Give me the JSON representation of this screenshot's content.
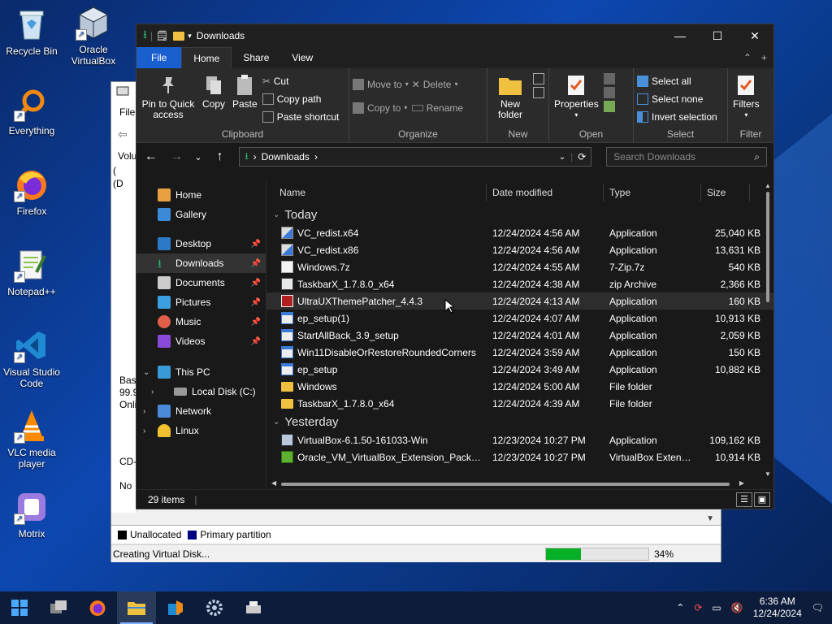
{
  "desktop": {
    "icons": [
      {
        "label": "Recycle Bin"
      },
      {
        "label": "Oracle VirtualBox"
      },
      {
        "label": "Everything"
      },
      {
        "label": "Firefox"
      },
      {
        "label": "Notepad++"
      },
      {
        "label": "Visual Studio Code"
      },
      {
        "label": "VLC media player"
      },
      {
        "label": "Motrix"
      }
    ]
  },
  "background_window": {
    "menu_file": "File",
    "col_volume": "Volu",
    "rows": [
      "(",
      "(D"
    ],
    "disk_info": [
      "Basi",
      "99.9",
      "Onli"
    ],
    "cd": "CD-",
    "cd_status": "No",
    "legend": [
      {
        "label": "Unallocated",
        "color": "#000000"
      },
      {
        "label": "Primary partition",
        "color": "#000080"
      }
    ],
    "status_text": "Creating Virtual Disk...",
    "progress_percent": 34,
    "progress_label": "34%"
  },
  "explorer": {
    "title": "Downloads",
    "tabs": {
      "file": "File",
      "home": "Home",
      "share": "Share",
      "view": "View"
    },
    "ribbon": {
      "clipboard": {
        "pin": "Pin to Quick access",
        "copy": "Copy",
        "paste": "Paste",
        "cut": "Cut",
        "copy_path": "Copy path",
        "paste_shortcut": "Paste shortcut",
        "label": "Clipboard"
      },
      "organize": {
        "move_to": "Move to",
        "copy_to": "Copy to",
        "delete": "Delete",
        "rename": "Rename",
        "label": "Organize"
      },
      "new": {
        "new_folder": "New folder",
        "label": "New"
      },
      "open": {
        "properties": "Properties",
        "label": "Open"
      },
      "select": {
        "select_all": "Select all",
        "select_none": "Select none",
        "invert": "Invert selection",
        "label": "Select"
      },
      "filter": {
        "filters": "Filters",
        "label": "Filter"
      }
    },
    "address": {
      "path": "Downloads"
    },
    "search": {
      "placeholder": "Search Downloads"
    },
    "nav": {
      "home": "Home",
      "gallery": "Gallery",
      "desktop": "Desktop",
      "downloads": "Downloads",
      "documents": "Documents",
      "pictures": "Pictures",
      "music": "Music",
      "videos": "Videos",
      "this_pc": "This PC",
      "local_disk": "Local Disk (C:)",
      "network": "Network",
      "linux": "Linux"
    },
    "columns": {
      "name": "Name",
      "date": "Date modified",
      "type": "Type",
      "size": "Size"
    },
    "groups": {
      "today": "Today",
      "yesterday": "Yesterday"
    },
    "files_today": [
      {
        "name": "VC_redist.x64",
        "date": "12/24/2024 4:56 AM",
        "type": "Application",
        "size": "25,040 KB",
        "icon": "installer"
      },
      {
        "name": "VC_redist.x86",
        "date": "12/24/2024 4:56 AM",
        "type": "Application",
        "size": "13,631 KB",
        "icon": "installer"
      },
      {
        "name": "Windows.7z",
        "date": "12/24/2024 4:55 AM",
        "type": "7-Zip.7z",
        "size": "540 KB",
        "icon": "file"
      },
      {
        "name": "TaskbarX_1.7.8.0_x64",
        "date": "12/24/2024 4:38 AM",
        "type": "zip Archive",
        "size": "2,366 KB",
        "icon": "zip"
      },
      {
        "name": "UltraUXThemePatcher_4.4.3",
        "date": "12/24/2024 4:13 AM",
        "type": "Application",
        "size": "160 KB",
        "icon": "patcher"
      },
      {
        "name": "ep_setup(1)",
        "date": "12/24/2024 4:07 AM",
        "type": "Application",
        "size": "10,913 KB",
        "icon": "app"
      },
      {
        "name": "StartAllBack_3.9_setup",
        "date": "12/24/2024 4:01 AM",
        "type": "Application",
        "size": "2,059 KB",
        "icon": "app"
      },
      {
        "name": "Win11DisableOrRestoreRoundedCorners",
        "date": "12/24/2024 3:59 AM",
        "type": "Application",
        "size": "150 KB",
        "icon": "app"
      },
      {
        "name": "ep_setup",
        "date": "12/24/2024 3:49 AM",
        "type": "Application",
        "size": "10,882 KB",
        "icon": "app"
      },
      {
        "name": "Windows",
        "date": "12/24/2024 5:00 AM",
        "type": "File folder",
        "size": "",
        "icon": "folder"
      },
      {
        "name": "TaskbarX_1.7.8.0_x64",
        "date": "12/24/2024 4:39 AM",
        "type": "File folder",
        "size": "",
        "icon": "folder"
      }
    ],
    "files_yesterday": [
      {
        "name": "VirtualBox-6.1.50-161033-Win",
        "date": "12/23/2024 10:27 PM",
        "type": "Application",
        "size": "109,162 KB",
        "icon": "vbox"
      },
      {
        "name": "Oracle_VM_VirtualBox_Extension_Pack-6....",
        "date": "12/23/2024 10:27 PM",
        "type": "VirtualBox Extensi...",
        "size": "10,914 KB",
        "icon": "cube"
      }
    ],
    "status": {
      "items": "29 items"
    }
  },
  "taskbar": {
    "time": "6:36 AM",
    "date": "12/24/2024"
  }
}
